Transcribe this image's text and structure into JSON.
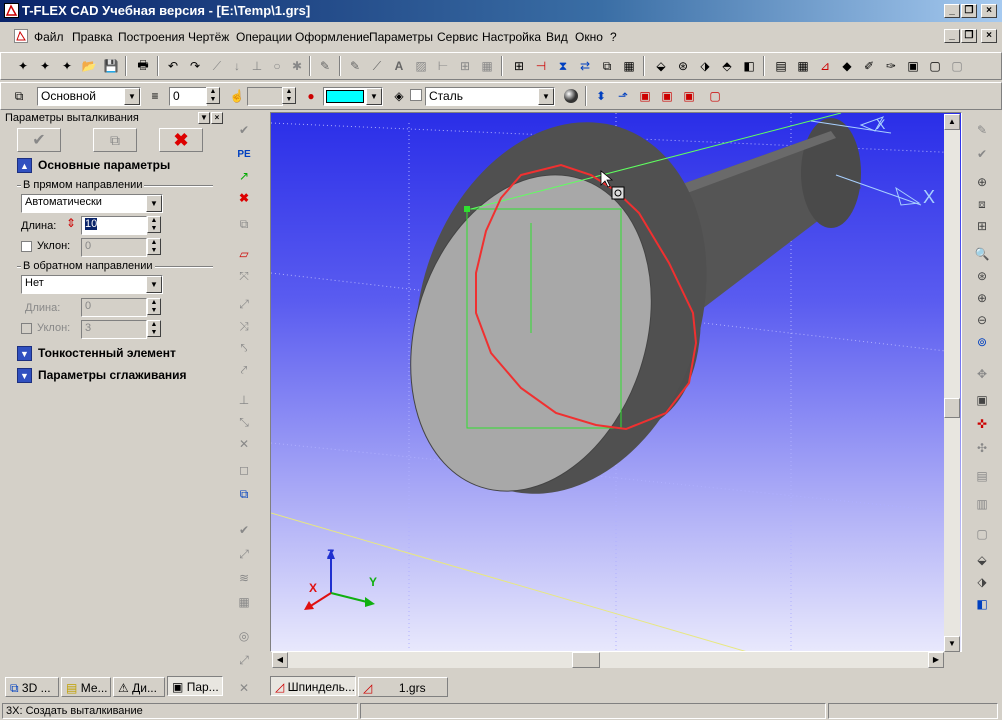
{
  "window": {
    "title": "T-FLEX CAD Учебная версия - [E:\\Temp\\1.grs]"
  },
  "menu": [
    "Файл",
    "Правка",
    "Построения",
    "Чертёж",
    "Операции",
    "Оформление",
    "Параметры",
    "Сервис",
    "Настройка",
    "Вид",
    "Окно",
    "?"
  ],
  "props": {
    "layer": "Основной",
    "level": "0",
    "material": "Сталь",
    "color": "#00ffff"
  },
  "panel": {
    "title": "Параметры выталкивания",
    "section_main": "Основные параметры",
    "group_forward": "В прямом направлении",
    "forward_mode": "Автоматически",
    "length_label": "Длина:",
    "length_value": "10",
    "slope_label": "Уклон:",
    "slope_value": "0",
    "group_backward": "В обратном направлении",
    "backward_mode": "Нет",
    "back_length_label": "Длина:",
    "back_length_value": "0",
    "back_slope_label": "Уклон:",
    "back_slope_value": "3",
    "section_thin": "Тонкостенный элемент",
    "section_smooth": "Параметры сглаживания"
  },
  "panel_tabs": [
    "3D ...",
    "Ме...",
    "Ди...",
    "Пар..."
  ],
  "doc_tabs": [
    "Шпиндель...",
    "1.grs"
  ],
  "axes": {
    "x": "X",
    "y": "Y",
    "z": "Z"
  },
  "status": {
    "text": "3Х: Создать выталкивание"
  },
  "icons": [
    "app-icon",
    "new-icon",
    "open-icon",
    "save-icon",
    "print-icon",
    "undo-icon",
    "redo-icon",
    "check-icon",
    "cancel-icon",
    "zoom-icon",
    "pan-icon",
    "rotate-icon"
  ]
}
